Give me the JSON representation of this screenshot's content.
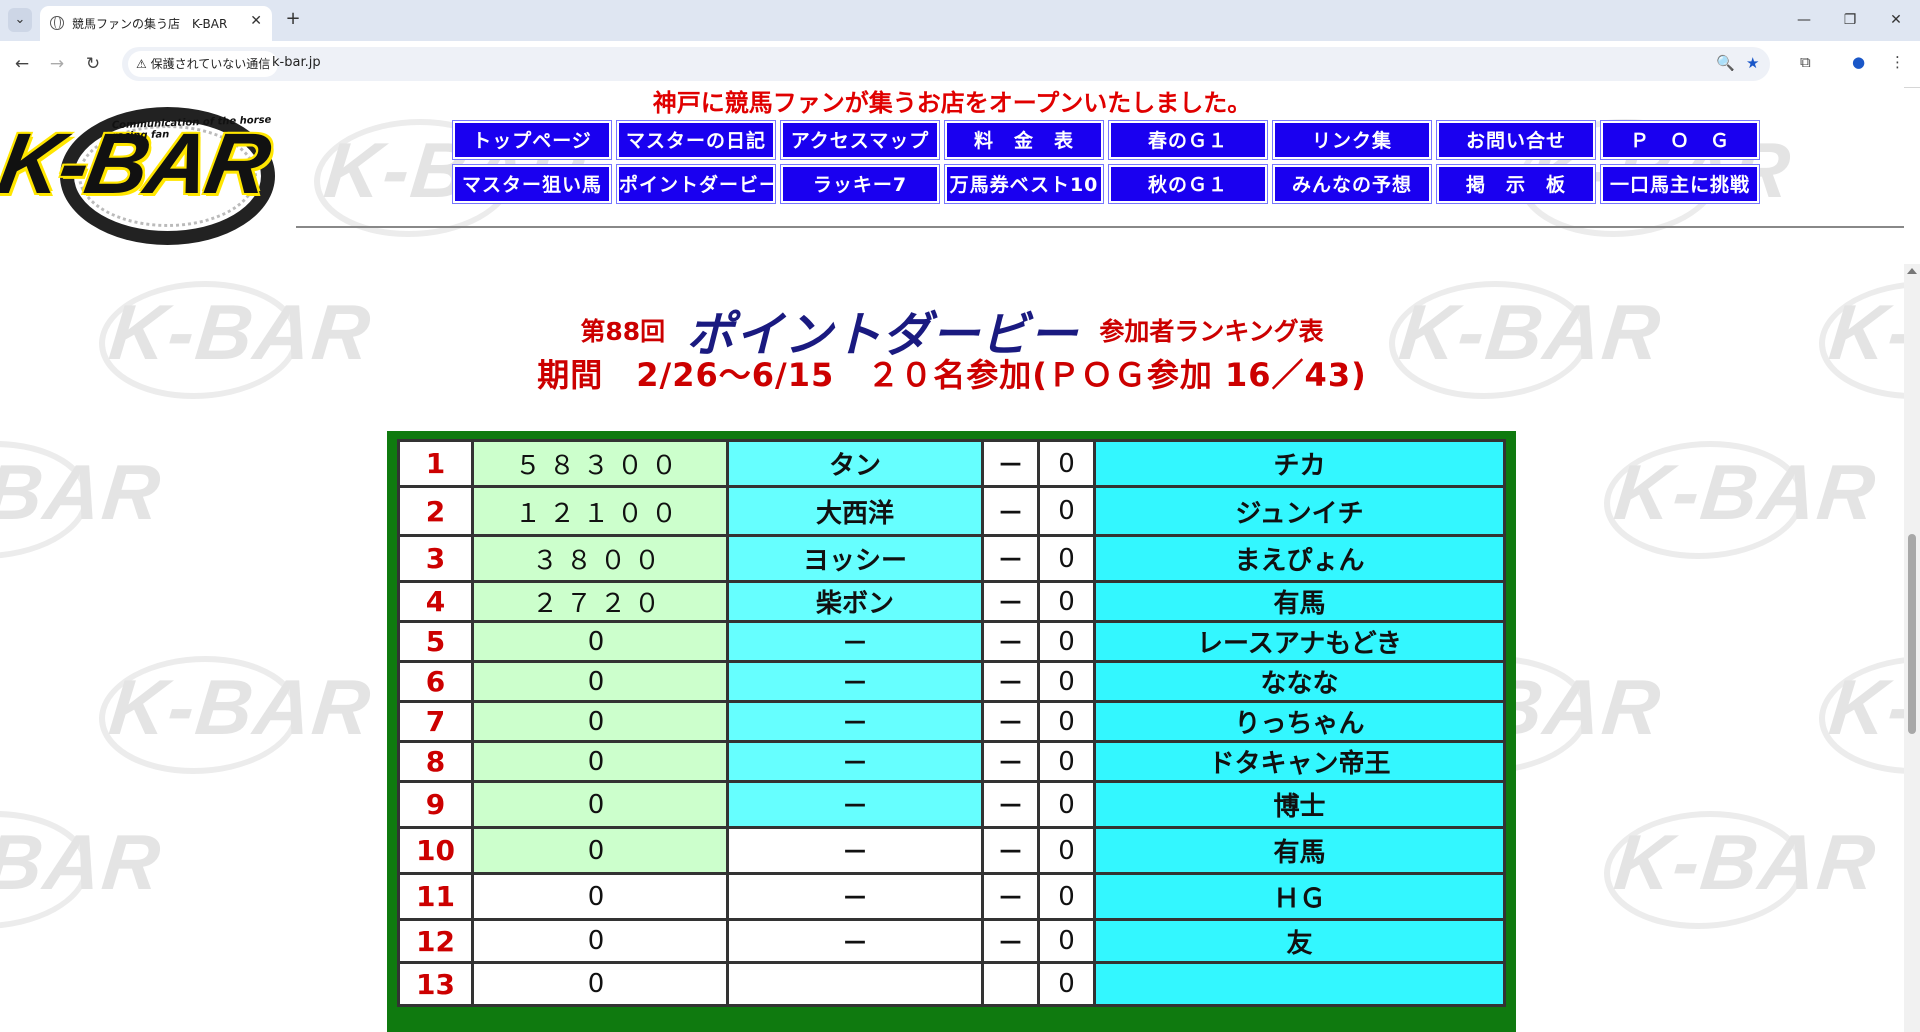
{
  "browser": {
    "tab_title": "競馬ファンの集う店　K-BAR",
    "security_label": "⚠ 保護されていない通信",
    "url": "k-bar.jp"
  },
  "header": {
    "logo_text": "K-BAR",
    "logo_tagline": "Communication of the horse racing fan",
    "announcement": "神戸に競馬ファンが集うお店をオープンいたしました。"
  },
  "menu": [
    [
      "トップページ",
      "マスターの日記",
      "アクセスマップ",
      "料　金　表",
      "春のＧ１",
      "リンク集",
      "お問い合せ",
      "Ｐ　Ｏ　Ｇ"
    ],
    [
      "マスター狙い馬",
      "ポイントダービー",
      "ラッキー7",
      "万馬券ベスト10",
      "秋のＧ１",
      "みんなの予想",
      "掲　示　板",
      "一口馬主に挑戦"
    ]
  ],
  "page": {
    "edition": "第88回",
    "title": "ポイントダービー",
    "subtitle": "参加者ランキング表",
    "period": "期間　2/26〜6/15　２０名参加(ＰＯＧ参加 16／43)"
  },
  "ranking": {
    "rows": [
      {
        "rank": "1",
        "points": "５８３００",
        "name": "タン",
        "dash": "－",
        "zero": "0",
        "player": "チカ"
      },
      {
        "rank": "2",
        "points": "１２１００",
        "name": "大西洋",
        "dash": "－",
        "zero": "0",
        "player": "ジュンイチ"
      },
      {
        "rank": "3",
        "points": "３８００",
        "name": "ヨッシー",
        "dash": "－",
        "zero": "0",
        "player": "まえぴょん"
      },
      {
        "rank": "4",
        "points": "２７２０",
        "name": "柴ボン",
        "dash": "－",
        "zero": "0",
        "player": "有馬"
      },
      {
        "rank": "5",
        "points": "0",
        "name": "－",
        "dash": "－",
        "zero": "0",
        "player": "レースアナもどき"
      },
      {
        "rank": "6",
        "points": "0",
        "name": "－",
        "dash": "－",
        "zero": "0",
        "player": "ななな"
      },
      {
        "rank": "7",
        "points": "0",
        "name": "－",
        "dash": "－",
        "zero": "0",
        "player": "りっちゃん"
      },
      {
        "rank": "8",
        "points": "0",
        "name": "－",
        "dash": "－",
        "zero": "0",
        "player": "ドタキャン帝王"
      },
      {
        "rank": "9",
        "points": "0",
        "name": "－",
        "dash": "－",
        "zero": "0",
        "player": "博士"
      },
      {
        "rank": "10",
        "points": "0",
        "name": "－",
        "dash": "－",
        "zero": "0",
        "player": "有馬"
      },
      {
        "rank": "11",
        "points": "0",
        "name": "－",
        "dash": "－",
        "zero": "0",
        "player": "ＨＧ"
      },
      {
        "rank": "12",
        "points": "0",
        "name": "－",
        "dash": "－",
        "zero": "0",
        "player": "友"
      },
      {
        "rank": "13",
        "points": "0",
        "name": "",
        "dash": "",
        "zero": "0",
        "player": ""
      }
    ]
  },
  "colors": {
    "menu_blue": "#1a00f0",
    "table_border_green": "#0f7a0f",
    "points_green": "#ccffcc",
    "name_cyan": "#66ffff",
    "player_cyan": "#33f7ff",
    "heading_red": "#cc0000"
  }
}
